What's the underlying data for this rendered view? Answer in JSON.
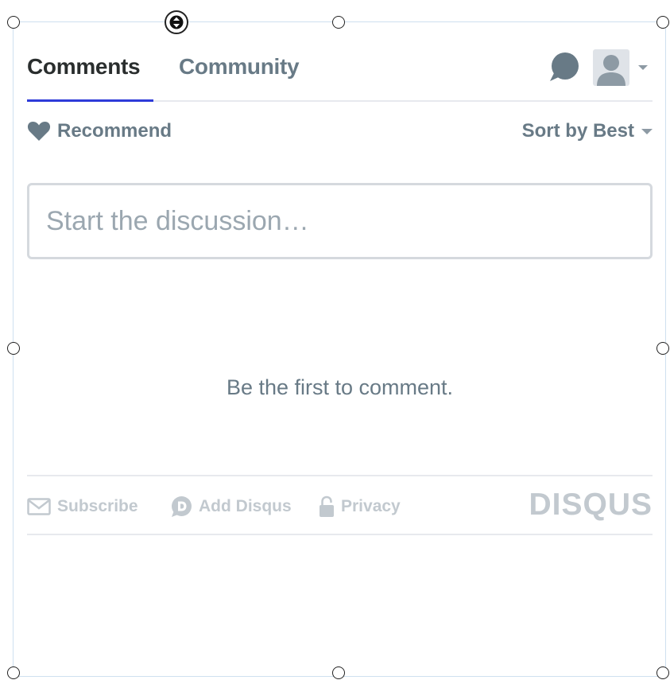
{
  "nav": {
    "tabs": [
      {
        "label": "Comments",
        "active": true
      },
      {
        "label": "Community",
        "active": false
      }
    ]
  },
  "toolbar": {
    "recommend_label": "Recommend",
    "sort_label": "Sort by Best"
  },
  "composer": {
    "placeholder": "Start the discussion…",
    "value": ""
  },
  "empty_message": "Be the first to comment.",
  "footer": {
    "links": [
      {
        "label": "Subscribe",
        "icon": "envelope-icon"
      },
      {
        "label": "Add Disqus",
        "icon": "disqus-d-icon"
      },
      {
        "label": "Privacy",
        "icon": "lock-icon"
      }
    ],
    "brand": "DISQUS"
  },
  "colors": {
    "accent": "#2e3bd9",
    "text_dark": "#2a2e2e",
    "text_muted": "#687a86",
    "footer_muted": "#c2c9cf",
    "border": "#e7e9ee"
  }
}
